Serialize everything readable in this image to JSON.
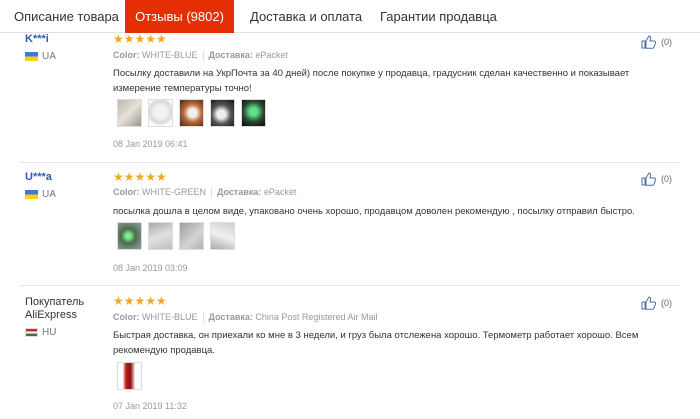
{
  "tabs": [
    {
      "label": "Описание товара",
      "active": false
    },
    {
      "label": "Отзывы (9802)",
      "active": true
    },
    {
      "label": "Доставка и оплата",
      "active": false
    },
    {
      "label": "Гарантии продавца",
      "active": false
    }
  ],
  "colors": {
    "accent": "#e62e04",
    "star": "#f5a623",
    "username": "#2a5db0"
  },
  "reviews": [
    {
      "user": "K***i",
      "country": "UA",
      "stars": "★★★★★",
      "color_label": "Color:",
      "color_value": "WHITE-BLUE",
      "delivery_label": "Доставка:",
      "delivery_value": "ePacket",
      "text": "Посылку доставили на УкрПочта за 40 дней) после покупке у продавца, градусник сделан качественно и показывает измерение температуры точно!",
      "date": "08 Jan 2019 06:41",
      "likes": "(0)"
    },
    {
      "user": "U***a",
      "country": "UA",
      "stars": "★★★★★",
      "color_label": "Color:",
      "color_value": "WHITE-GREEN",
      "delivery_label": "Доставка:",
      "delivery_value": "ePacket",
      "text": "посылка дошла в целом виде, упаковано очень хорошо, продавцом доволен рекомендую , посылку отправил быстро.",
      "date": "08 Jan 2019 03:09",
      "likes": "(0)"
    },
    {
      "user": "Покупатель AliExpress",
      "country": "HU",
      "stars": "★★★★★",
      "color_label": "Color:",
      "color_value": "WHITE-BLUE",
      "delivery_label": "Доставка:",
      "delivery_value": "China Post Registered Air Mail",
      "text": "Быстрая доставка, он приехали ко мне в 3 недели, и груз была отслежена хорошо. Термометр работает хорошо. Всем рекомендую продавца.",
      "date": "07 Jan 2019 11:32",
      "likes": "(0)"
    }
  ]
}
